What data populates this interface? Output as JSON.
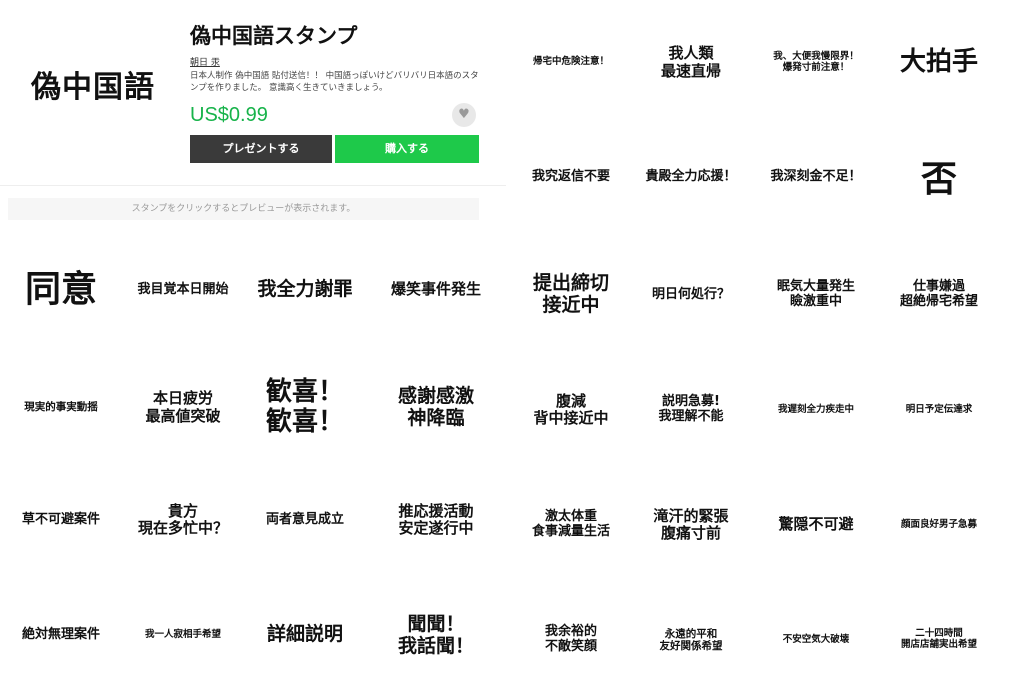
{
  "product": {
    "logo_text": "偽中国語",
    "title": "偽中国語スタンプ",
    "author": "朝日 汞",
    "description": "日本人制作 偽中国語 貼付送信！！ 中国語っぽいけどバリバリ日本語のスタンプを作りました。 意識高く生きていきましょう。",
    "price": "US$0.99",
    "favorite_icon": "heart-icon",
    "present_label": "プレゼントする",
    "buy_label": "購入する",
    "preview_hint": "スタンプをクリックするとプレビューが表示されます。"
  },
  "stickers": [
    {
      "text": "帰宅中危険注意！"
    },
    {
      "text": "我人類\n最速直帰"
    },
    {
      "text": "我、大便我慢限界！\n爆発寸前注意！"
    },
    {
      "text": "大拍手"
    },
    {
      "text": "我究返信不要"
    },
    {
      "text": "貴殿全力応援！"
    },
    {
      "text": "我深刻金不足！"
    },
    {
      "text": "否"
    },
    {
      "text": "同意"
    },
    {
      "text": "我目覚本日開始"
    },
    {
      "text": "我全力謝罪"
    },
    {
      "text": "爆笑事件発生"
    },
    {
      "text": "提出締切\n接近中"
    },
    {
      "text": "明日何処行？"
    },
    {
      "text": "眠気大量発生\n瞼激重中"
    },
    {
      "text": "仕事嫌過\n超絶帰宅希望"
    },
    {
      "text": "現実的事実動揺"
    },
    {
      "text": "本日疲労\n最高値突破"
    },
    {
      "text": "歓喜！\n歓喜！"
    },
    {
      "text": "感謝感激\n神降臨"
    },
    {
      "text": "腹減\n背中接近中"
    },
    {
      "text": "説明急募!\n我理解不能"
    },
    {
      "text": "我遅刻全力疾走中"
    },
    {
      "text": "明日予定伝達求"
    },
    {
      "text": "草不可避案件"
    },
    {
      "text": "貴方\n現在多忙中？"
    },
    {
      "text": "両者意見成立"
    },
    {
      "text": "推応援活動\n安定遂行中"
    },
    {
      "text": "激太体重\n食事減量生活"
    },
    {
      "text": "滝汗的緊張\n腹痛寸前"
    },
    {
      "text": "驚隠不可避"
    },
    {
      "text": "顔面良好男子急募"
    },
    {
      "text": "絶対無理案件"
    },
    {
      "text": "我一人寂相手希望"
    },
    {
      "text": "詳細説明"
    },
    {
      "text": "聞聞！\n我話聞！"
    },
    {
      "text": "我余裕的\n不敵笑顔"
    },
    {
      "text": "永遠的平和\n友好関係希望"
    },
    {
      "text": "不安空気大破壊"
    },
    {
      "text": "二十四時間\n開店店舗実出希望"
    }
  ]
}
